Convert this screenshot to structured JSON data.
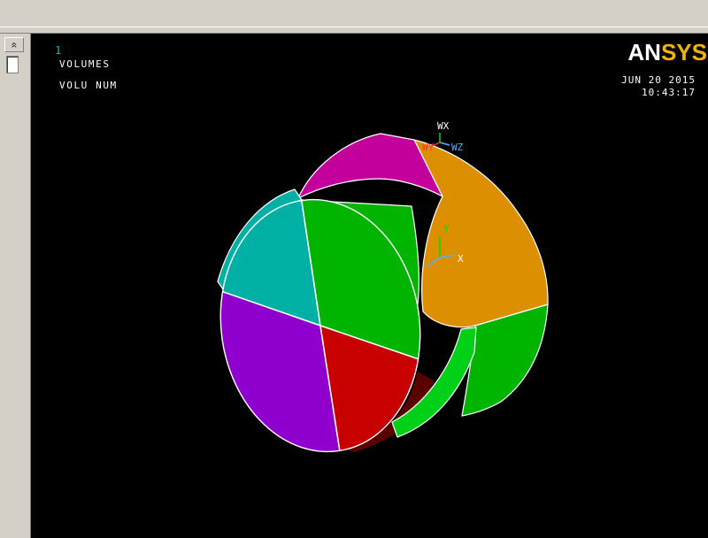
{
  "chrome": {
    "collapse_glyph": "«"
  },
  "graphics": {
    "plot_number": "1",
    "annotations": {
      "line1": "VOLUMES",
      "line2": "VOLU NUM"
    },
    "logo": {
      "part1": "AN",
      "part2": "SYS"
    },
    "date": "JUN 20 2015",
    "time": "10:43:17",
    "triad_wp": {
      "wx": "WX",
      "wy": "WY",
      "wz": "WZ"
    },
    "triad_global": {
      "x": "X",
      "y": "Y"
    },
    "palette": {
      "background": "#000000",
      "chrome": "#d4d0c8",
      "magenta": "#c4009c",
      "orange": "#dc8f00",
      "teal": "#00b0a4",
      "green_face": "#00b400",
      "green_bright": "#00d018",
      "purple": "#8f00cf",
      "red": "#c80000",
      "dark_red": "#5a0000",
      "edge": "#ffffff",
      "logo_gold": "#f0b400",
      "label_teal": "#00c8a0",
      "text_white": "#ffffff",
      "wz_blue": "#58b0ff",
      "wy_red": "#ff3030",
      "y_green": "#00dd00"
    }
  }
}
